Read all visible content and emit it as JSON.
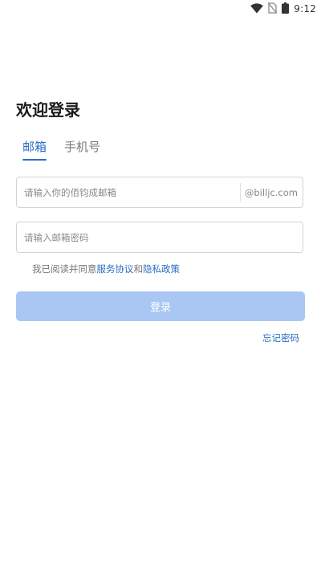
{
  "status_bar": {
    "time": "9:12",
    "icons": [
      "wifi-icon",
      "no-sim-icon",
      "battery-icon"
    ]
  },
  "login": {
    "title": "欢迎登录",
    "tabs": [
      {
        "label": "邮箱",
        "active": true
      },
      {
        "label": "手机号",
        "active": false
      }
    ],
    "email": {
      "placeholder": "请输入你的佰钧成邮箱",
      "value": "",
      "suffix": "@billjc.com"
    },
    "password": {
      "placeholder": "请输入邮箱密码",
      "value": ""
    },
    "agreement": {
      "prefix": "我已阅读并同意",
      "service_link": "服务协议",
      "conjunction": "和",
      "privacy_link": "隐私政策"
    },
    "login_button": "登录",
    "forgot_password": "忘记密码"
  },
  "colors": {
    "accent": "#2c6ec4",
    "button_disabled": "#a9c7f2",
    "title": "#1a1a1a",
    "muted_text": "#777777",
    "border": "#d4d4d4"
  }
}
